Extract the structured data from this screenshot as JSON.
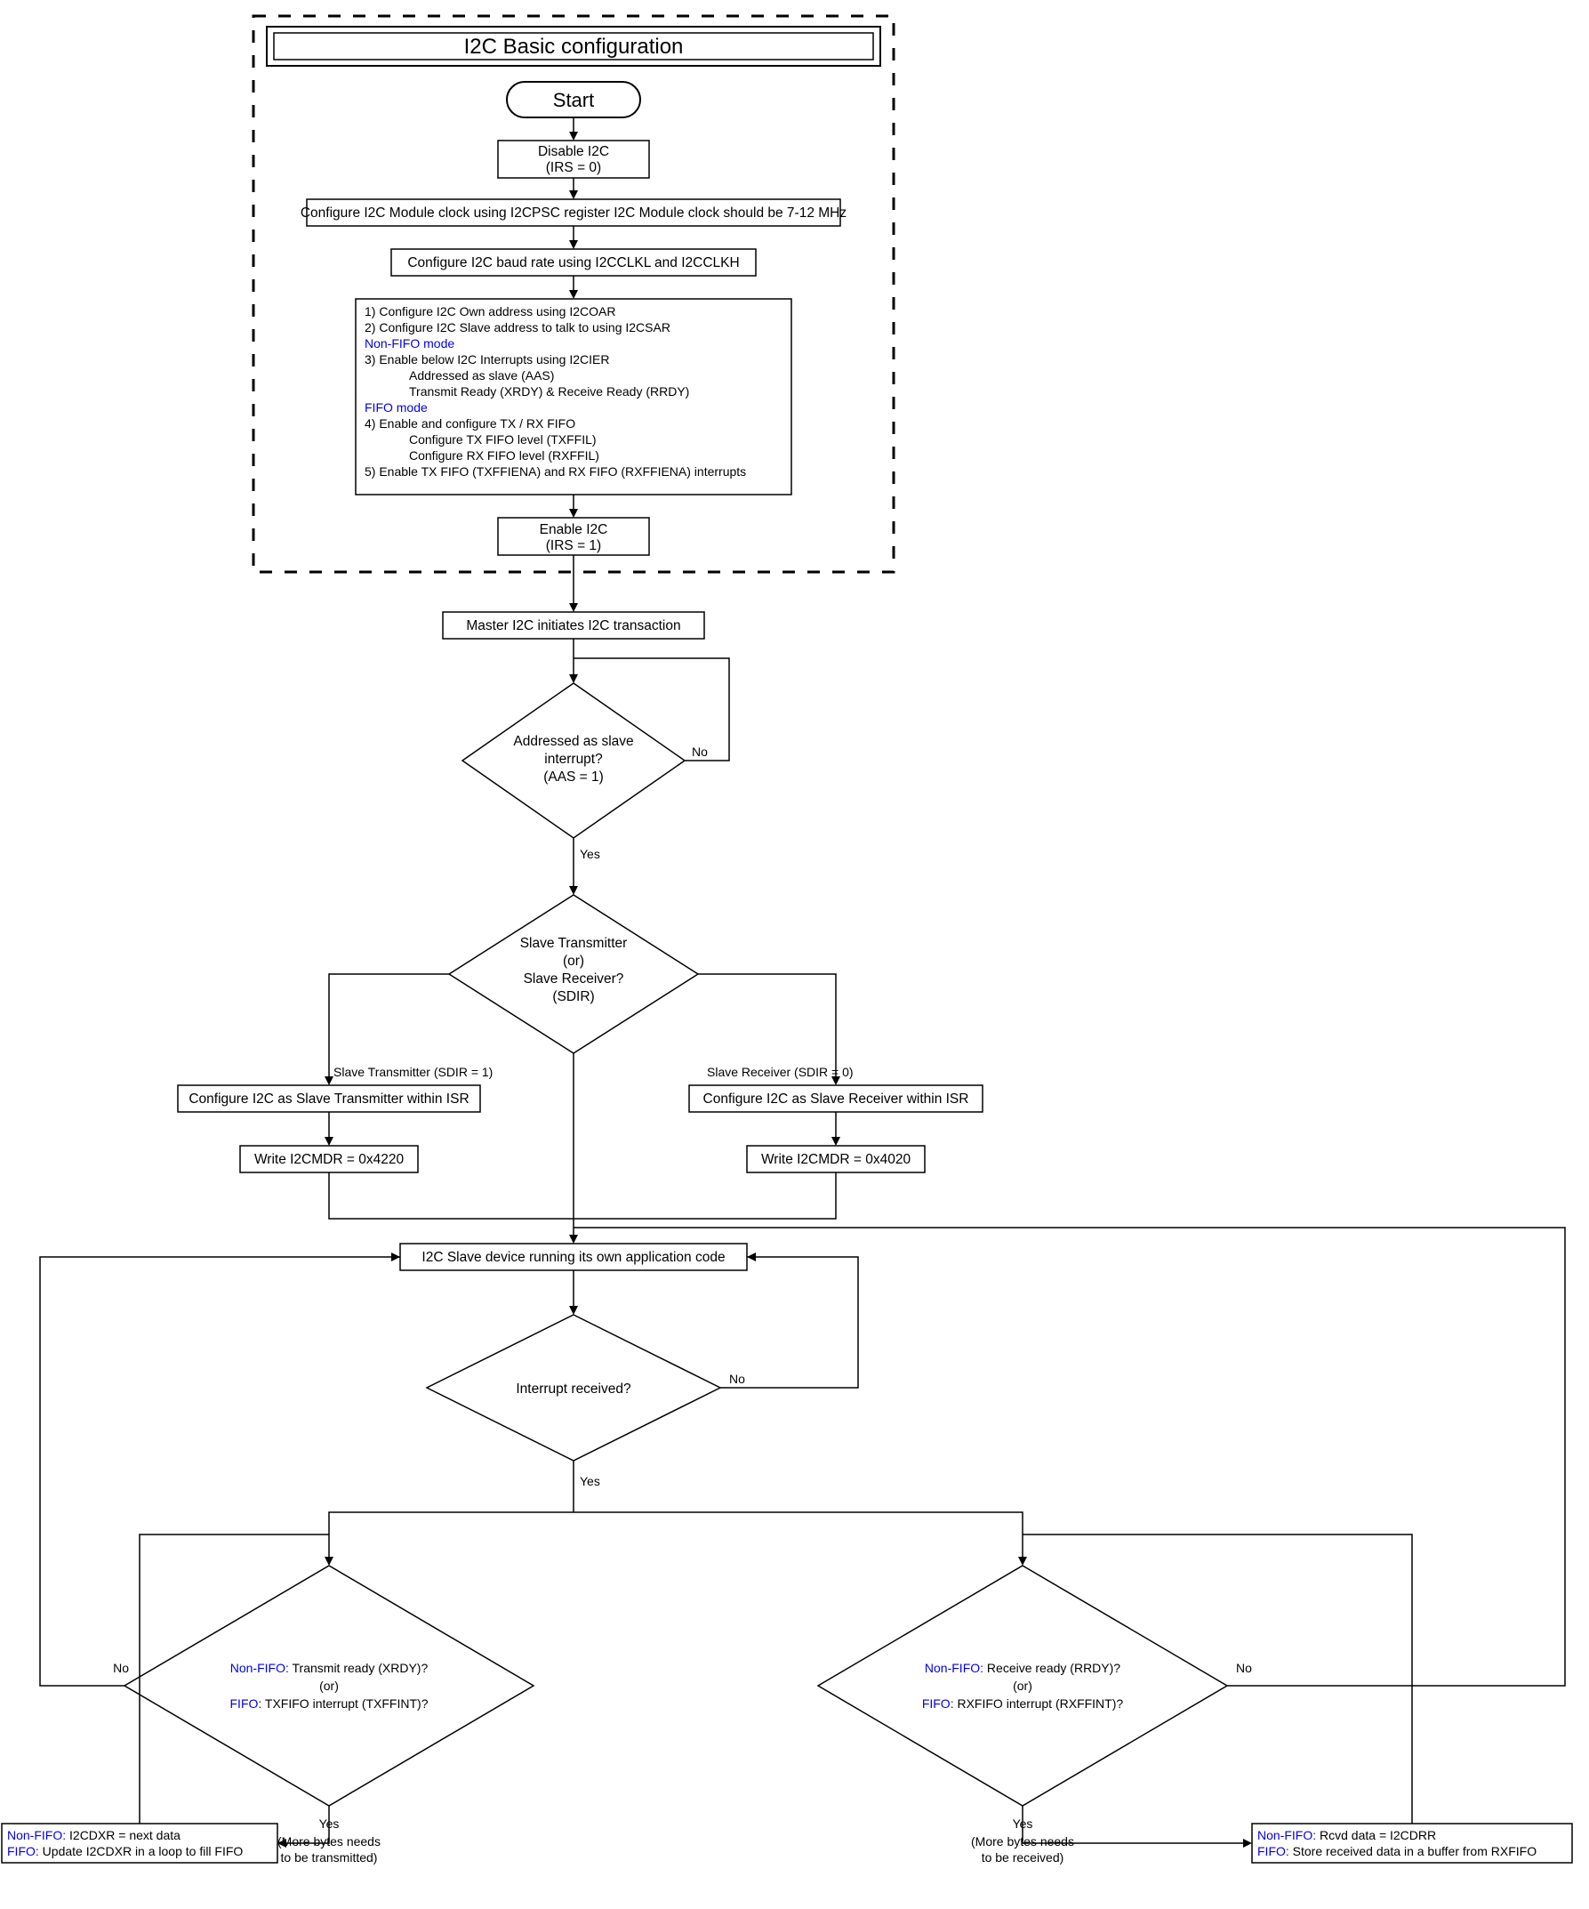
{
  "title": "I2C Basic configuration",
  "start": "Start",
  "n_disable_l1": "Disable I2C",
  "n_disable_l2": "(IRS = 0)",
  "n_cfgclk": "Configure I2C Module clock using I2CPSC register I2C Module clock should be 7-12 MHz",
  "n_baud": "Configure I2C baud rate using I2CCLKL and I2CCLKH",
  "big_l1": "1) Configure I2C Own address using I2COAR",
  "big_l2": "2) Configure I2C Slave address to talk to using I2CSAR",
  "big_l3": "Non-FIFO mode",
  "big_l4": "3) Enable below I2C Interrupts using I2CIER",
  "big_l5": "Addressed as slave (AAS)",
  "big_l6": "Transmit Ready (XRDY) & Receive Ready (RRDY)",
  "big_l7": "FIFO mode",
  "big_l8": "4) Enable and configure TX / RX FIFO",
  "big_l9": "Configure TX FIFO level (TXFFIL)",
  "big_l10": "Configure RX FIFO level (RXFFIL)",
  "big_l11": "5) Enable TX FIFO (TXFFIENA) and RX FIFO (RXFFIENA) interrupts",
  "n_enable_l1": "Enable I2C",
  "n_enable_l2": "(IRS = 1)",
  "n_master": "Master I2C initiates I2C transaction",
  "d_aas_l1": "Addressed as slave",
  "d_aas_l2": "interrupt?",
  "d_aas_l3": "(AAS = 1)",
  "d_sdir_l1": "Slave Transmitter",
  "d_sdir_l2": "(or)",
  "d_sdir_l3": "Slave Receiver?",
  "d_sdir_l4": "(SDIR)",
  "lbl_tx": "Slave Transmitter (SDIR = 1)",
  "lbl_rx": "Slave Receiver (SDIR = 0)",
  "n_cfgtx": "Configure I2C as Slave Transmitter within ISR",
  "n_cfgrx": "Configure I2C as Slave Receiver within ISR",
  "n_wr_tx": "Write I2CMDR = 0x4220",
  "n_wr_rx": "Write I2CMDR = 0x4020",
  "n_app": "I2C Slave device running its own application code",
  "d_irq": "Interrupt received?",
  "d_tx_l1a": "Non-FIFO:",
  "d_tx_l1b": " Transmit ready (XRDY)?",
  "d_tx_l2": "(or)",
  "d_tx_l3a": "FIFO:",
  "d_tx_l3b": " TXFIFO interrupt (TXFFINT)?",
  "d_rx_l1a": "Non-FIFO:",
  "d_rx_l1b": " Receive ready (RRDY)?",
  "d_rx_l2": "(or)",
  "d_rx_l3a": "FIFO:",
  "d_rx_l3b": " RXFIFO interrupt (RXFFINT)?",
  "n_txdata_l1a": "Non-FIFO:",
  "n_txdata_l1b": " I2CDXR = next data",
  "n_txdata_l2a": "FIFO:",
  "n_txdata_l2b": " Update I2CDXR in a loop to fill FIFO",
  "n_rxdata_l1a": "Non-FIFO:",
  "n_rxdata_l1b": " Rcvd data = I2CDRR",
  "n_rxdata_l2a": "FIFO:",
  "n_rxdata_l2b": " Store received data in a buffer from RXFIFO",
  "yes": "Yes",
  "no": "No",
  "more_tx_l1": "(More bytes needs",
  "more_tx_l2": "to be transmitted)",
  "more_rx_l1": "(More bytes needs",
  "more_rx_l2": "to be received)"
}
